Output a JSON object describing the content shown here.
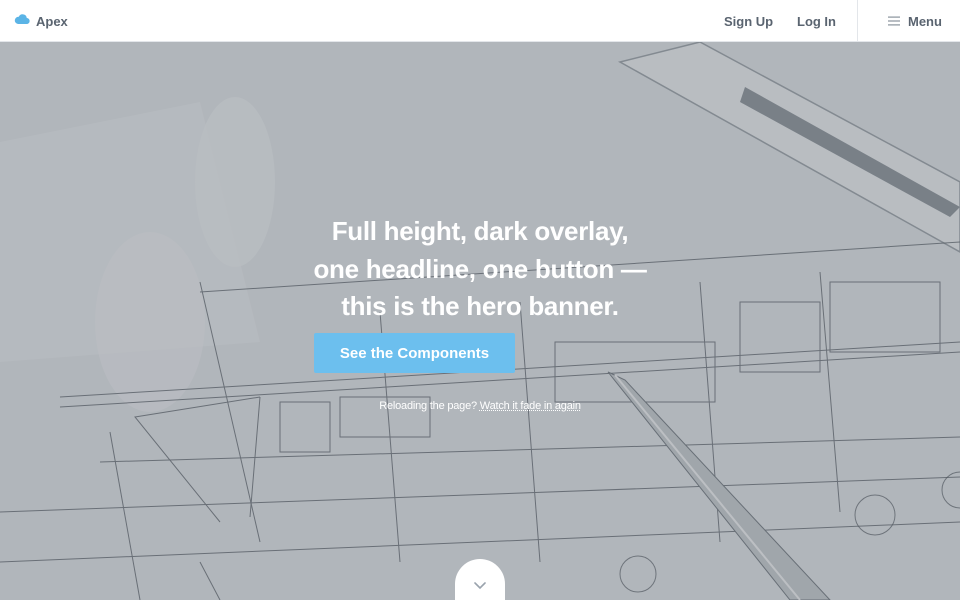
{
  "nav": {
    "brand": "Apex",
    "brand_icon": "cloud-icon",
    "signup": "Sign Up",
    "login": "Log In",
    "menu": "Menu",
    "menu_icon": "hamburger-icon"
  },
  "hero": {
    "headline_lines": [
      "Full height, dark overlay,",
      "one headline, one button —",
      "this is the hero banner."
    ],
    "button": "See the Components",
    "note_prefix": "Reloading the page? ",
    "note_link": "Watch it fade in again",
    "scroll_icon": "chevron-down-icon",
    "background": "architectural blueprint with pen and ruler"
  },
  "colors": {
    "accent": "#6cbfee",
    "nav_text": "#5a6470",
    "overlay": "#5f666e"
  }
}
